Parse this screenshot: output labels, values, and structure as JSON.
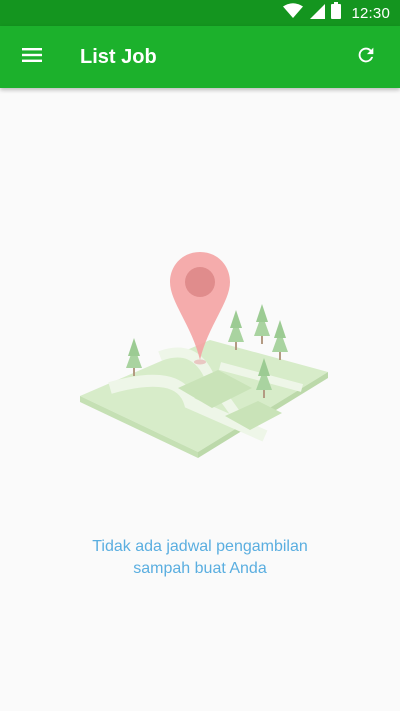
{
  "status_bar": {
    "time": "12:30",
    "icons": [
      "wifi-icon",
      "cell-signal-icon",
      "battery-icon"
    ]
  },
  "app_bar": {
    "title": "List Job",
    "menu_icon": "hamburger-menu-icon",
    "refresh_icon": "refresh-icon"
  },
  "empty_state": {
    "illustration": "map-pin-park-illustration",
    "message_line1": "Tidak ada jadwal pengambilan",
    "message_line2": "sampah buat Anda"
  },
  "colors": {
    "status_bar": "#14951f",
    "app_bar": "#1cb12c",
    "background": "#fafafa",
    "message_text": "#5aaee0",
    "pin": "#f08a8a"
  }
}
